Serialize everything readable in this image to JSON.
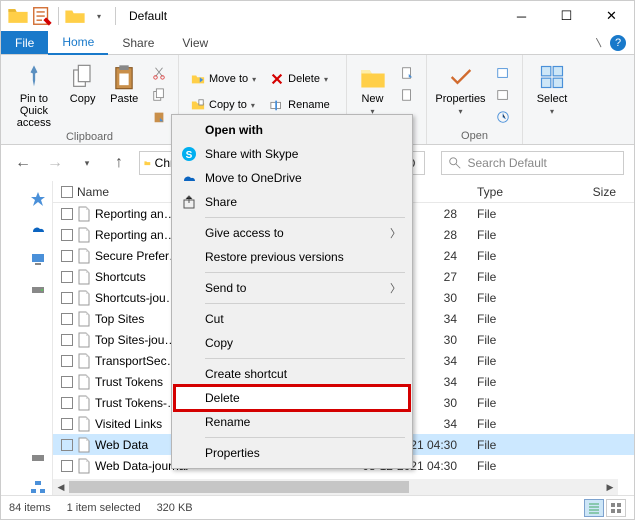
{
  "window": {
    "title": "Default"
  },
  "tabs": {
    "file": "File",
    "home": "Home",
    "share": "Share",
    "view": "View"
  },
  "ribbon": {
    "pin": "Pin to Quick\naccess",
    "copy": "Copy",
    "paste": "Paste",
    "clipboard_label": "Clipboard",
    "moveto": "Move to",
    "copyto": "Copy to",
    "delete": "Delete",
    "rename": "Rename",
    "new": "New",
    "properties": "Properties",
    "open_label": "Open",
    "select": "Select"
  },
  "address": {
    "crumb": "Chr",
    "search_placeholder": "Search Default"
  },
  "columns": {
    "name": "Name",
    "date": "",
    "type": "Type",
    "size": "Size"
  },
  "files": [
    {
      "name": "Reporting an…",
      "date": "28",
      "type": "File"
    },
    {
      "name": "Reporting an…",
      "date": "28",
      "type": "File"
    },
    {
      "name": "Secure Prefer…",
      "date": "24",
      "type": "File"
    },
    {
      "name": "Shortcuts",
      "date": "27",
      "type": "File"
    },
    {
      "name": "Shortcuts-jou…",
      "date": "30",
      "type": "File"
    },
    {
      "name": "Top Sites",
      "date": "34",
      "type": "File"
    },
    {
      "name": "Top Sites-jou…",
      "date": "30",
      "type": "File"
    },
    {
      "name": "TransportSec…",
      "date": "34",
      "type": "File"
    },
    {
      "name": "Trust Tokens",
      "date": "34",
      "type": "File"
    },
    {
      "name": "Trust Tokens-…",
      "date": "30",
      "type": "File"
    },
    {
      "name": "Visited Links",
      "date": "34",
      "type": "File"
    },
    {
      "name": "Web Data",
      "date": "08-12-2021 04:30",
      "type": "File",
      "selected": true
    },
    {
      "name": "Web Data-journal",
      "date": "08-12-2021 04:30",
      "type": "File"
    }
  ],
  "context": {
    "openwith": "Open with",
    "skype": "Share with Skype",
    "onedrive": "Move to OneDrive",
    "share": "Share",
    "giveaccess": "Give access to",
    "restore": "Restore previous versions",
    "sendto": "Send to",
    "cut": "Cut",
    "copy": "Copy",
    "shortcut": "Create shortcut",
    "delete": "Delete",
    "rename": "Rename",
    "properties": "Properties"
  },
  "status": {
    "items": "84 items",
    "selected": "1 item selected",
    "size": "320 KB"
  }
}
